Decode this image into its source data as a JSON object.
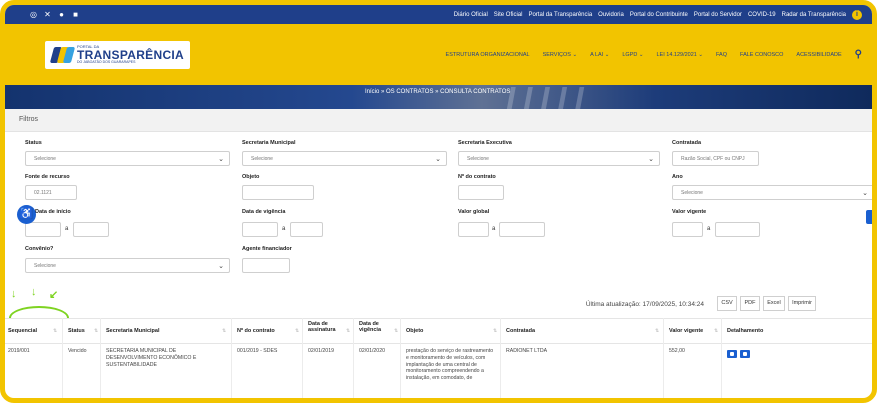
{
  "topbar": {
    "social_icons": [
      "instagram-icon",
      "x-icon",
      "facebook-icon",
      "youtube-icon"
    ],
    "links": [
      "Diário Oficial",
      "Site Oficial",
      "Portal da Transparência",
      "Ouvidoria",
      "Portal do Contribuinte",
      "Portal do Servidor",
      "COVID-19",
      "Radar da Transparência"
    ],
    "info_icon": "i"
  },
  "header": {
    "logo_small": "PORTAL DA",
    "logo_big": "TRANSPARÊNCIA",
    "logo_sub": "DO JABOATÃO DOS GUARARAPES",
    "nav": [
      "ESTRUTURA ORGANIZACIONAL",
      "SERVIÇOS ⌄",
      "A LAI ⌄",
      "LGPD ⌄",
      "LEI 14.129/2021 ⌄",
      "FAQ",
      "FALE CONOSCO",
      "ACESSIBILIDADE"
    ],
    "search_icon": "search-icon"
  },
  "banner": {
    "breadcrumb": "Início » OS CONTRATOS » CONSULTA CONTRATOS"
  },
  "filtros": {
    "title": "Filtros",
    "status_label": "Status",
    "status_value": "Selecione",
    "secretaria_label": "Secretaria Municipal",
    "secretaria_value": "Selecione",
    "executiva_label": "Secretaria Executiva",
    "executiva_value": "Selecione",
    "contratada_label": "Contratada",
    "contratada_placeholder": "Razão Social, CPF ou CNPJ",
    "fonte_label": "Fonte de recurso",
    "fonte_value": "02.1121",
    "objeto_label": "Objeto",
    "ncontrato_label": "Nº do contrato",
    "ano_label": "Ano",
    "ano_value": "Selecione",
    "data_inicio_label": "Data de início",
    "data_vigencia_label": "Data de vigência",
    "valor_global_label": "Valor global",
    "valor_vigente_label": "Valor vigente",
    "range_sep": "a",
    "convenio_label": "Convênio?",
    "convenio_value": "Selecione",
    "agente_label": "Agente financiador"
  },
  "update": {
    "text": "Última atualização: 17/09/2025, 10:34:24",
    "buttons": [
      "CSV",
      "PDF",
      "Excel",
      "Imprimir"
    ]
  },
  "table": {
    "headers": [
      "Sequencial",
      "Status",
      "Secretaria Municipal",
      "Nº do contrato",
      "Data de assinatura",
      "Data de vigência",
      "Objeto",
      "Contratada",
      "Valor vigente",
      "Detalhamento"
    ],
    "row": {
      "sequencial": "2019/001",
      "status": "Vencido",
      "secretaria": "SECRETARIA MUNICIPAL DE DESENVOLVIMENTO ECONÔMICO E SUSTENTABILIDADE",
      "ncontrato": "001/2019 - SDES",
      "assinatura": "02/01/2019",
      "vigencia": "02/01/2020",
      "objeto": "prestação do serviço de rastreamento e monitoramento de veículos, com implantação de uma central de monitoramento compreendendo a instalação, em comodato, de",
      "contratada": "RADIONET LTDA",
      "valor": "552,00"
    }
  },
  "colors": {
    "navy": "#1f3f8a",
    "yellow": "#f2c400",
    "accent_blue": "#1a5fd0",
    "annotation_green": "#7ed321"
  }
}
